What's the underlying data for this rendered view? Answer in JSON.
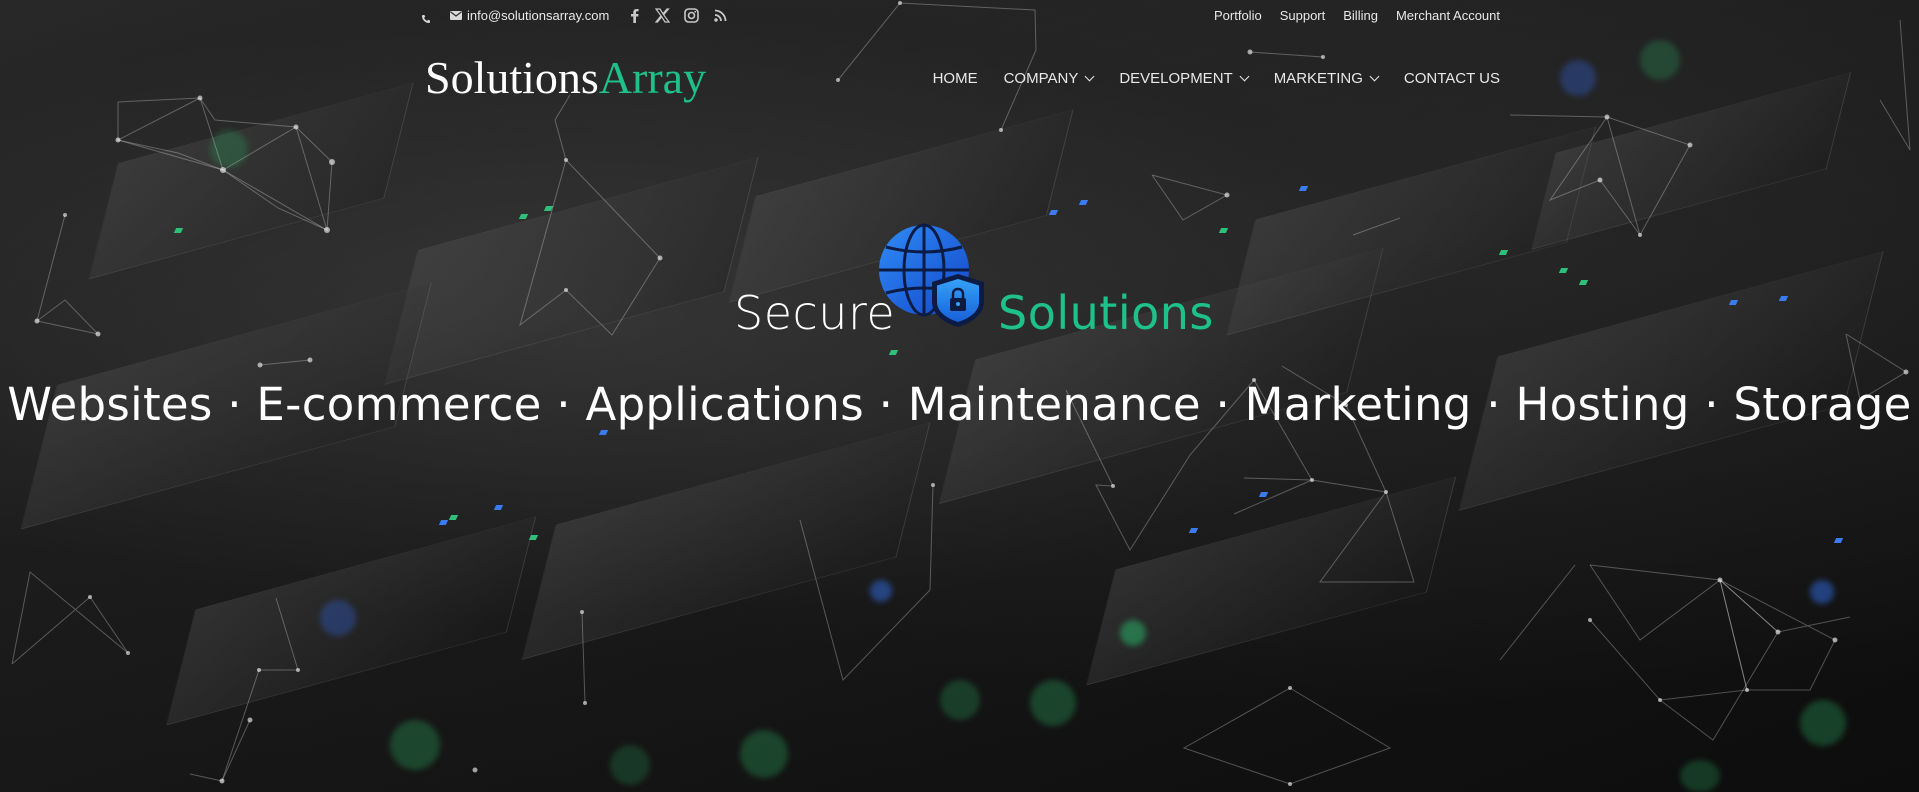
{
  "top_bar": {
    "email": "info@solutionsarray.com",
    "social_icons": [
      "facebook-icon",
      "x-icon",
      "instagram-icon",
      "rss-icon"
    ],
    "secondary_links": [
      "Portfolio",
      "Support",
      "Billing",
      "Merchant Account"
    ]
  },
  "header": {
    "logo_part_1": "Solutions",
    "logo_part_2": "Array",
    "nav": [
      {
        "label": "HOME",
        "has_dropdown": false
      },
      {
        "label": "COMPANY",
        "has_dropdown": true
      },
      {
        "label": "DEVELOPMENT",
        "has_dropdown": true
      },
      {
        "label": "MARKETING",
        "has_dropdown": true
      },
      {
        "label": "CONTACT US",
        "has_dropdown": false
      }
    ]
  },
  "hero": {
    "word_1": "Secure",
    "word_2": "Solutions",
    "services": "Websites · E-commerce · Applications · Maintenance · Marketing · Hosting · Storage",
    "icon": "globe-shield-lock-icon"
  },
  "colors": {
    "accent": "#1fc18a",
    "text": "#ffffff",
    "globe_blue": "#1a6df0"
  }
}
